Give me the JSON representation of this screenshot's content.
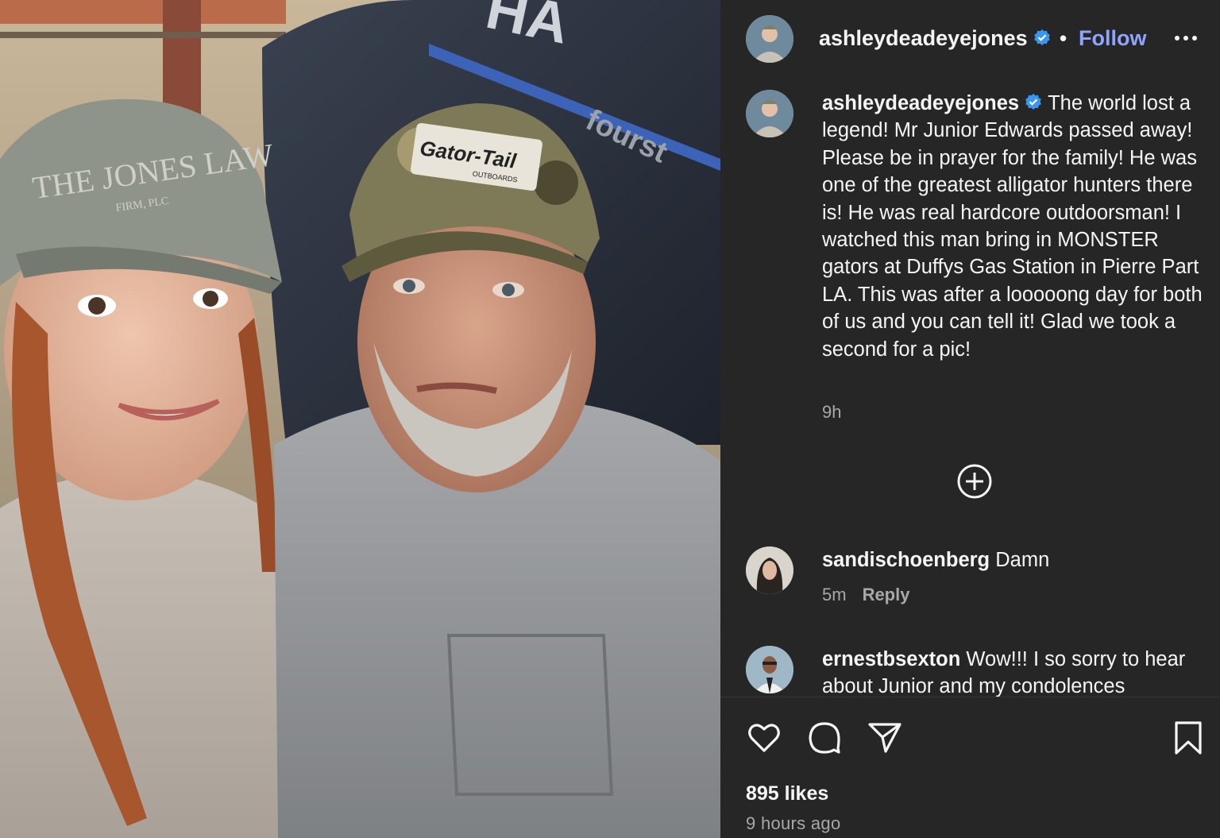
{
  "photo": {
    "hat_left_text": "THE JONES LAW",
    "hat_left_sub": "FIRM, PLC",
    "hat_right_text": "Gator-Tail",
    "hat_right_sub": "OUTBOARDS",
    "motor_brand": "HA",
    "motor_model": "fourst"
  },
  "header": {
    "username": "ashleydeadeyejones",
    "separator": "•",
    "follow_label": "Follow"
  },
  "caption": {
    "username": "ashleydeadeyejones",
    "text": "The world lost a legend! Mr Junior Edwards passed away! Please be in prayer for the family! He was one of the greatest alligator hunters there is! He was real hardcore outdoorsman! I watched this man bring in MONSTER gators at Duffys Gas Station in Pierre Part LA. This was after a looooong day for both of us and you can tell it! Glad we took a second for a pic!",
    "time": "9h"
  },
  "comments": [
    {
      "username": "sandischoenberg",
      "text": "Damn",
      "time": "5m",
      "reply_label": "Reply"
    },
    {
      "username": "ernestbsexton",
      "text": "Wow!!! I so sorry to hear about Junior and my condolences"
    }
  ],
  "footer": {
    "likes": "895 likes",
    "time_ago": "9 hours ago"
  },
  "icons": {
    "verified_color": "#3897f0",
    "follow_color": "#8fa4ff"
  }
}
